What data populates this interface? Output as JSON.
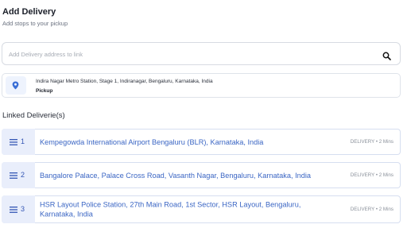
{
  "header": {
    "title": "Add Delivery",
    "subtitle": "Add stops to your pickup"
  },
  "search": {
    "placeholder": "Add Delivery address to link",
    "value": "",
    "icon": "search-icon"
  },
  "pickup": {
    "address": "Indira Nagar Metro Station, Stage 1, Indiranagar, Bengaluru, Karnataka, India",
    "label": "Pickup",
    "icon": "map-pin-icon"
  },
  "linked": {
    "title": "Linked Deliverie(s)",
    "items": [
      {
        "number": "1",
        "address": "Kempegowda International Airport Bengaluru (BLR), Karnataka, India",
        "meta": "DELIVERY • 2 Mins"
      },
      {
        "number": "2",
        "address": "Bangalore Palace, Palace Cross Road, Vasanth Nagar, Bengaluru, Karnataka, India",
        "meta": "DELIVERY • 2 Mins"
      },
      {
        "number": "3",
        "address": "HSR Layout Police Station, 27th Main Road, 1st Sector, HSR Layout, Bengaluru, Karnataka, India",
        "meta": "DELIVERY • 2 Mins"
      }
    ]
  },
  "colors": {
    "accent": "#3b66c4",
    "handle_bg": "#e9eefb",
    "pin": "#3b6fd6"
  }
}
